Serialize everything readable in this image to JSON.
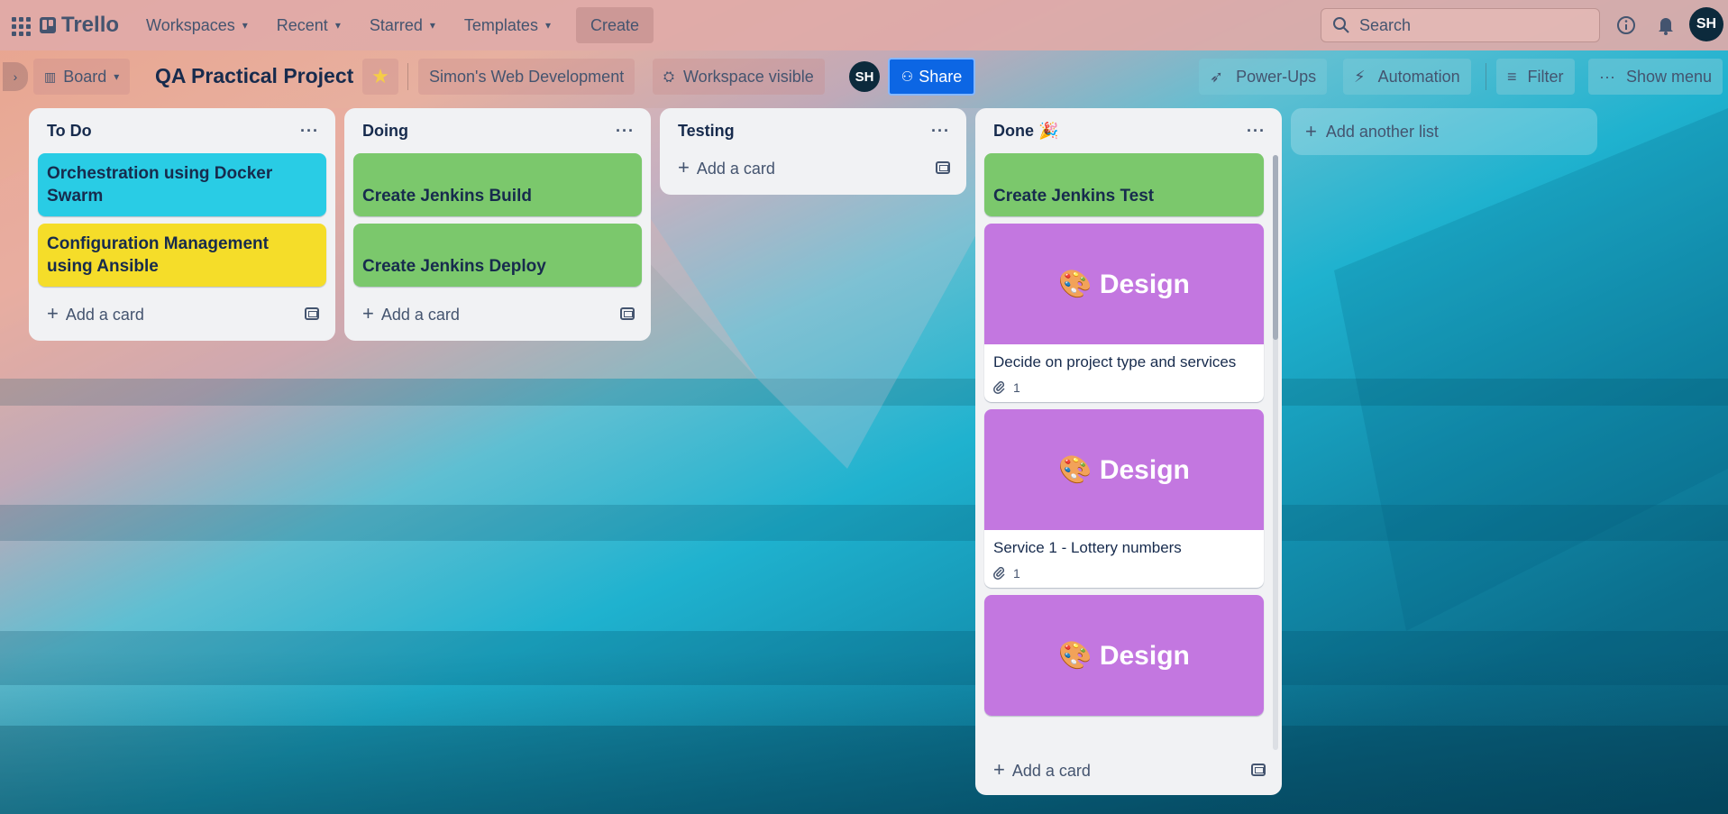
{
  "nav": {
    "logo": "Trello",
    "items": [
      {
        "label": "Workspaces"
      },
      {
        "label": "Recent"
      },
      {
        "label": "Starred"
      },
      {
        "label": "Templates"
      }
    ],
    "create": "Create",
    "search_placeholder": "Search",
    "avatar": "SH"
  },
  "board": {
    "view": "Board",
    "title": "QA Practical Project",
    "workspace": "Simon's Web Development",
    "visibility": "Workspace visible",
    "member_avatar": "SH",
    "share": "Share",
    "power_ups": "Power-Ups",
    "automation": "Automation",
    "filter": "Filter",
    "show_menu": "Show menu",
    "add_list": "Add another list"
  },
  "lists": [
    {
      "title": "To Do",
      "menu": "···",
      "add_card": "Add a card",
      "cards": [
        {
          "title": "Orchestration using Docker Swarm",
          "color": "#29cce5"
        },
        {
          "title": "Configuration Management using Ansible",
          "color": "#f5dd29"
        }
      ]
    },
    {
      "title": "Doing",
      "menu": "···",
      "add_card": "Add a card",
      "cards": [
        {
          "title": "Create Jenkins Build",
          "color": "#7bc86c"
        },
        {
          "title": "Create Jenkins Deploy",
          "color": "#7bc86c"
        }
      ]
    },
    {
      "title": "Testing",
      "menu": "···",
      "add_card": "Add a card",
      "cards": []
    },
    {
      "title": "Done 🎉",
      "menu": "···",
      "add_card": "Add a card",
      "cards": [
        {
          "title": "Create Jenkins Test",
          "color": "#7bc86c"
        },
        {
          "cover": "🎨 Design",
          "title": "Decide on project type and services",
          "attachments": "1"
        },
        {
          "cover": "🎨 Design",
          "title": "Service 1 - Lottery numbers",
          "attachments": "1"
        },
        {
          "cover": "🎨 Design"
        }
      ]
    }
  ]
}
